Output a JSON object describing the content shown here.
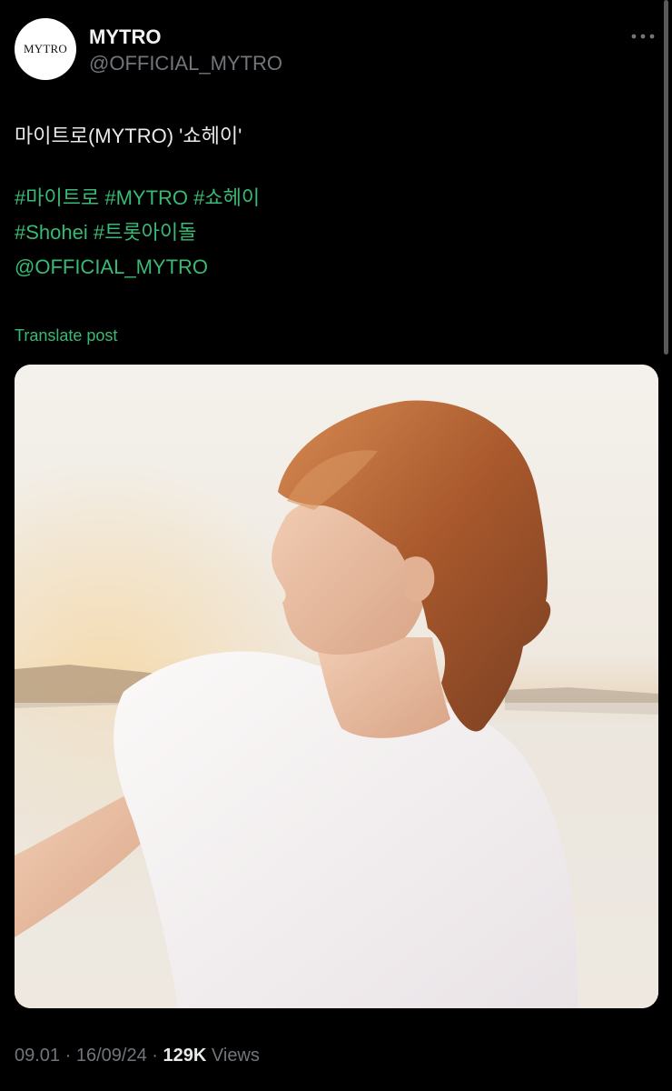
{
  "author": {
    "avatar_text": "MYTRO",
    "display_name": "MYTRO",
    "handle": "@OFFICIAL_MYTRO"
  },
  "post": {
    "text": "마이트로(MYTRO) '쇼헤이'",
    "tag_lines": [
      [
        "#마이트로",
        "#MYTRO",
        "#쇼헤이"
      ],
      [
        "#Shohei",
        "#트롯아이돌"
      ],
      [
        "@OFFICIAL_MYTRO"
      ]
    ],
    "translate_label": "Translate post",
    "time": "09.01",
    "date": "16/09/24",
    "separator": "·",
    "views_count": "129K",
    "views_label": "Views"
  },
  "icons": {
    "more": "more-horizontal-icon"
  },
  "colors": {
    "background": "#000000",
    "text": "#e7e9ea",
    "muted": "#71767b",
    "link": "#39ba74"
  }
}
